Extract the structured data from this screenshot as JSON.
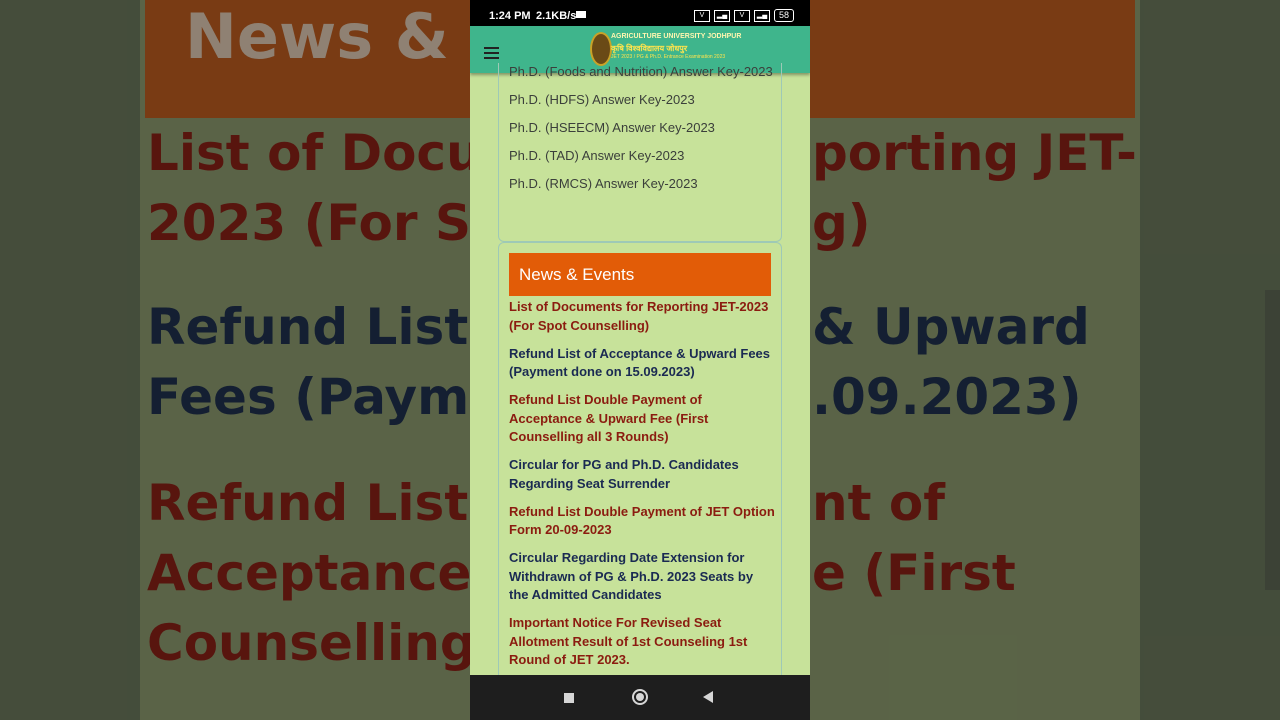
{
  "status": {
    "time": "1:24 PM",
    "rate": "2.1KB/s",
    "battery": "58"
  },
  "header": {
    "logo_title": "AGRICULTURE UNIVERSITY JODHPUR",
    "logo_sub": "कृषि विश्वविद्यालय जोधपुर",
    "logo_sub2": "JET 2023 / PG & Ph.D. Entrance Examination 2023"
  },
  "answer_keys": [
    "Ph.D. (Foods and Nutrition) Answer Key-2023",
    "Ph.D. (HDFS) Answer Key-2023",
    "Ph.D. (HSEECM) Answer Key-2023",
    "Ph.D. (TAD) Answer Key-2023",
    "Ph.D. (RMCS) Answer Key-2023"
  ],
  "news": {
    "title": "News & Events",
    "items": [
      "List of Documents for Reporting JET-2023 (For Spot Counselling)",
      "Refund List of Acceptance & Upward Fees (Payment done on 15.09.2023)",
      "Refund List Double Payment of Acceptance & Upward Fee (First Counselling all 3 Rounds)",
      "Circular for PG and Ph.D. Candidates Regarding Seat Surrender",
      "Refund List Double Payment of JET Option Form 20-09-2023",
      "Circular Regarding Date Extension for Withdrawn of PG & Ph.D. 2023 Seats by the Admitted Candidates",
      "Important Notice For Revised Seat Allotment Result of 1st Counseling 1st Round of JET 2023."
    ]
  },
  "background": {
    "title": "News & Ev",
    "lines": [
      "List of Docum",
      "porting JET-",
      "2023 (For Spo",
      "g)",
      "Refund List o",
      "& Upward",
      "Fees (Payme",
      ".09.2023)",
      "Refund List D",
      "nt of",
      "Acceptance",
      "e (First",
      "Counselling"
    ]
  }
}
